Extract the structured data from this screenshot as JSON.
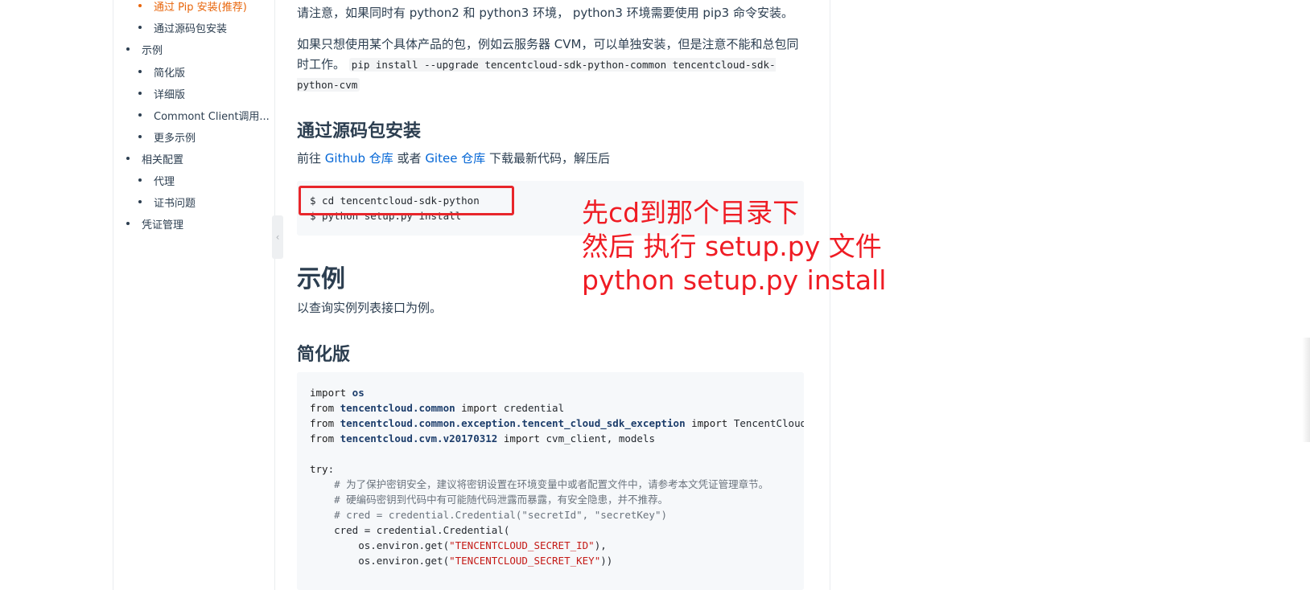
{
  "sidebar": {
    "items": [
      {
        "label": "通过 Pip 安装(推荐)",
        "level": 2,
        "active": true
      },
      {
        "label": "通过源码包安装",
        "level": 2,
        "active": false
      },
      {
        "label": "示例",
        "level": 1,
        "active": false
      },
      {
        "label": "简化版",
        "level": 2,
        "active": false
      },
      {
        "label": "详细版",
        "level": 2,
        "active": false
      },
      {
        "label": "Commont Client调用...",
        "level": 2,
        "active": false
      },
      {
        "label": "更多示例",
        "level": 2,
        "active": false
      },
      {
        "label": "相关配置",
        "level": 1,
        "active": false
      },
      {
        "label": "代理",
        "level": 2,
        "active": false
      },
      {
        "label": "证书问题",
        "level": 2,
        "active": false
      },
      {
        "label": "凭证管理",
        "level": 1,
        "active": false
      }
    ],
    "collapse_glyph": "‹"
  },
  "main": {
    "para1": "请注意，如果同时有 python2 和 python3 环境， python3 环境需要使用 pip3 命令安装。",
    "para2_text": "如果只想使用某个具体产品的包，例如云服务器 CVM，可以单独安装，但是注意不能和总包同时工作。",
    "para2_code": "pip install --upgrade tencentcloud-sdk-python-common tencentcloud-sdk-python-cvm",
    "h_source": "通过源码包安装",
    "para3_prefix": "前往 ",
    "para3_link1": "Github 仓库",
    "para3_mid": " 或者 ",
    "para3_link2": "Gitee 仓库",
    "para3_suffix": " 下载最新代码，解压后",
    "install_code": [
      "$ cd tencentcloud-sdk-python",
      "$ python setup.py install"
    ],
    "h_example": "示例",
    "para4": "以查询实例列表接口为例。",
    "h_simple": "简化版",
    "simple_code": {
      "l1_kw": "import",
      "l1_mod": " os",
      "l2_kw": "from",
      "l2_mod": " tencentcloud.common",
      "l2_kw2": " import",
      "l2_rest": " credential",
      "l3_kw": "from",
      "l3_mod": " tencentcloud.common.exception.tencent_cloud_sdk_exception",
      "l3_kw2": " import",
      "l3_rest": " TencentCloudSDKException",
      "l4_kw": "from",
      "l4_mod": " tencentcloud.cvm.v20170312",
      "l4_kw2": " import",
      "l4_rest": " cvm_client, models",
      "l6_kw": "try",
      "l6_rest": ":",
      "l7": "    # 为了保护密钥安全，建议将密钥设置在环境变量中或者配置文件中，请参考本文凭证管理章节。",
      "l8": "    # 硬编码密钥到代码中有可能随代码泄露而暴露，有安全隐患，并不推荐。",
      "l9": "    # cred = credential.Credential(\"secretId\", \"secretKey\")",
      "l10": "    cred = credential.Credential(",
      "l11_a": "        os.environ.get(",
      "l11_s": "\"TENCENTCLOUD_SECRET_ID\"",
      "l11_b": "),",
      "l12_a": "        os.environ.get(",
      "l12_s": "\"TENCENTCLOUD_SECRET_KEY\"",
      "l12_b": "))"
    }
  },
  "annotation": {
    "lines": [
      "先cd到那个目录下",
      "然后 执行 setup.py 文件",
      "python setup.py install"
    ],
    "color": "#ef1c24"
  }
}
